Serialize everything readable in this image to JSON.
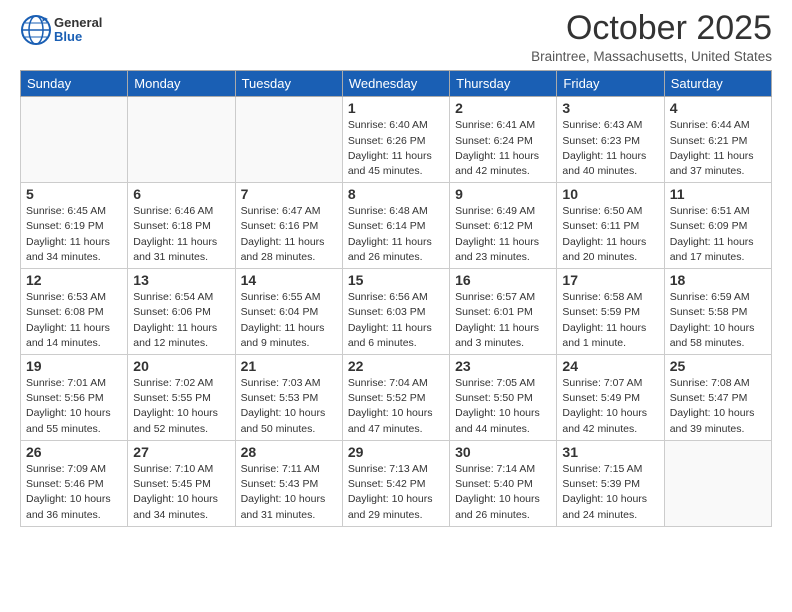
{
  "header": {
    "logo_general": "General",
    "logo_blue": "Blue",
    "month": "October 2025",
    "location": "Braintree, Massachusetts, United States"
  },
  "weekdays": [
    "Sunday",
    "Monday",
    "Tuesday",
    "Wednesday",
    "Thursday",
    "Friday",
    "Saturday"
  ],
  "weeks": [
    [
      {
        "day": "",
        "info": ""
      },
      {
        "day": "",
        "info": ""
      },
      {
        "day": "",
        "info": ""
      },
      {
        "day": "1",
        "info": "Sunrise: 6:40 AM\nSunset: 6:26 PM\nDaylight: 11 hours\nand 45 minutes."
      },
      {
        "day": "2",
        "info": "Sunrise: 6:41 AM\nSunset: 6:24 PM\nDaylight: 11 hours\nand 42 minutes."
      },
      {
        "day": "3",
        "info": "Sunrise: 6:43 AM\nSunset: 6:23 PM\nDaylight: 11 hours\nand 40 minutes."
      },
      {
        "day": "4",
        "info": "Sunrise: 6:44 AM\nSunset: 6:21 PM\nDaylight: 11 hours\nand 37 minutes."
      }
    ],
    [
      {
        "day": "5",
        "info": "Sunrise: 6:45 AM\nSunset: 6:19 PM\nDaylight: 11 hours\nand 34 minutes."
      },
      {
        "day": "6",
        "info": "Sunrise: 6:46 AM\nSunset: 6:18 PM\nDaylight: 11 hours\nand 31 minutes."
      },
      {
        "day": "7",
        "info": "Sunrise: 6:47 AM\nSunset: 6:16 PM\nDaylight: 11 hours\nand 28 minutes."
      },
      {
        "day": "8",
        "info": "Sunrise: 6:48 AM\nSunset: 6:14 PM\nDaylight: 11 hours\nand 26 minutes."
      },
      {
        "day": "9",
        "info": "Sunrise: 6:49 AM\nSunset: 6:12 PM\nDaylight: 11 hours\nand 23 minutes."
      },
      {
        "day": "10",
        "info": "Sunrise: 6:50 AM\nSunset: 6:11 PM\nDaylight: 11 hours\nand 20 minutes."
      },
      {
        "day": "11",
        "info": "Sunrise: 6:51 AM\nSunset: 6:09 PM\nDaylight: 11 hours\nand 17 minutes."
      }
    ],
    [
      {
        "day": "12",
        "info": "Sunrise: 6:53 AM\nSunset: 6:08 PM\nDaylight: 11 hours\nand 14 minutes."
      },
      {
        "day": "13",
        "info": "Sunrise: 6:54 AM\nSunset: 6:06 PM\nDaylight: 11 hours\nand 12 minutes."
      },
      {
        "day": "14",
        "info": "Sunrise: 6:55 AM\nSunset: 6:04 PM\nDaylight: 11 hours\nand 9 minutes."
      },
      {
        "day": "15",
        "info": "Sunrise: 6:56 AM\nSunset: 6:03 PM\nDaylight: 11 hours\nand 6 minutes."
      },
      {
        "day": "16",
        "info": "Sunrise: 6:57 AM\nSunset: 6:01 PM\nDaylight: 11 hours\nand 3 minutes."
      },
      {
        "day": "17",
        "info": "Sunrise: 6:58 AM\nSunset: 5:59 PM\nDaylight: 11 hours\nand 1 minute."
      },
      {
        "day": "18",
        "info": "Sunrise: 6:59 AM\nSunset: 5:58 PM\nDaylight: 10 hours\nand 58 minutes."
      }
    ],
    [
      {
        "day": "19",
        "info": "Sunrise: 7:01 AM\nSunset: 5:56 PM\nDaylight: 10 hours\nand 55 minutes."
      },
      {
        "day": "20",
        "info": "Sunrise: 7:02 AM\nSunset: 5:55 PM\nDaylight: 10 hours\nand 52 minutes."
      },
      {
        "day": "21",
        "info": "Sunrise: 7:03 AM\nSunset: 5:53 PM\nDaylight: 10 hours\nand 50 minutes."
      },
      {
        "day": "22",
        "info": "Sunrise: 7:04 AM\nSunset: 5:52 PM\nDaylight: 10 hours\nand 47 minutes."
      },
      {
        "day": "23",
        "info": "Sunrise: 7:05 AM\nSunset: 5:50 PM\nDaylight: 10 hours\nand 44 minutes."
      },
      {
        "day": "24",
        "info": "Sunrise: 7:07 AM\nSunset: 5:49 PM\nDaylight: 10 hours\nand 42 minutes."
      },
      {
        "day": "25",
        "info": "Sunrise: 7:08 AM\nSunset: 5:47 PM\nDaylight: 10 hours\nand 39 minutes."
      }
    ],
    [
      {
        "day": "26",
        "info": "Sunrise: 7:09 AM\nSunset: 5:46 PM\nDaylight: 10 hours\nand 36 minutes."
      },
      {
        "day": "27",
        "info": "Sunrise: 7:10 AM\nSunset: 5:45 PM\nDaylight: 10 hours\nand 34 minutes."
      },
      {
        "day": "28",
        "info": "Sunrise: 7:11 AM\nSunset: 5:43 PM\nDaylight: 10 hours\nand 31 minutes."
      },
      {
        "day": "29",
        "info": "Sunrise: 7:13 AM\nSunset: 5:42 PM\nDaylight: 10 hours\nand 29 minutes."
      },
      {
        "day": "30",
        "info": "Sunrise: 7:14 AM\nSunset: 5:40 PM\nDaylight: 10 hours\nand 26 minutes."
      },
      {
        "day": "31",
        "info": "Sunrise: 7:15 AM\nSunset: 5:39 PM\nDaylight: 10 hours\nand 24 minutes."
      },
      {
        "day": "",
        "info": ""
      }
    ]
  ]
}
